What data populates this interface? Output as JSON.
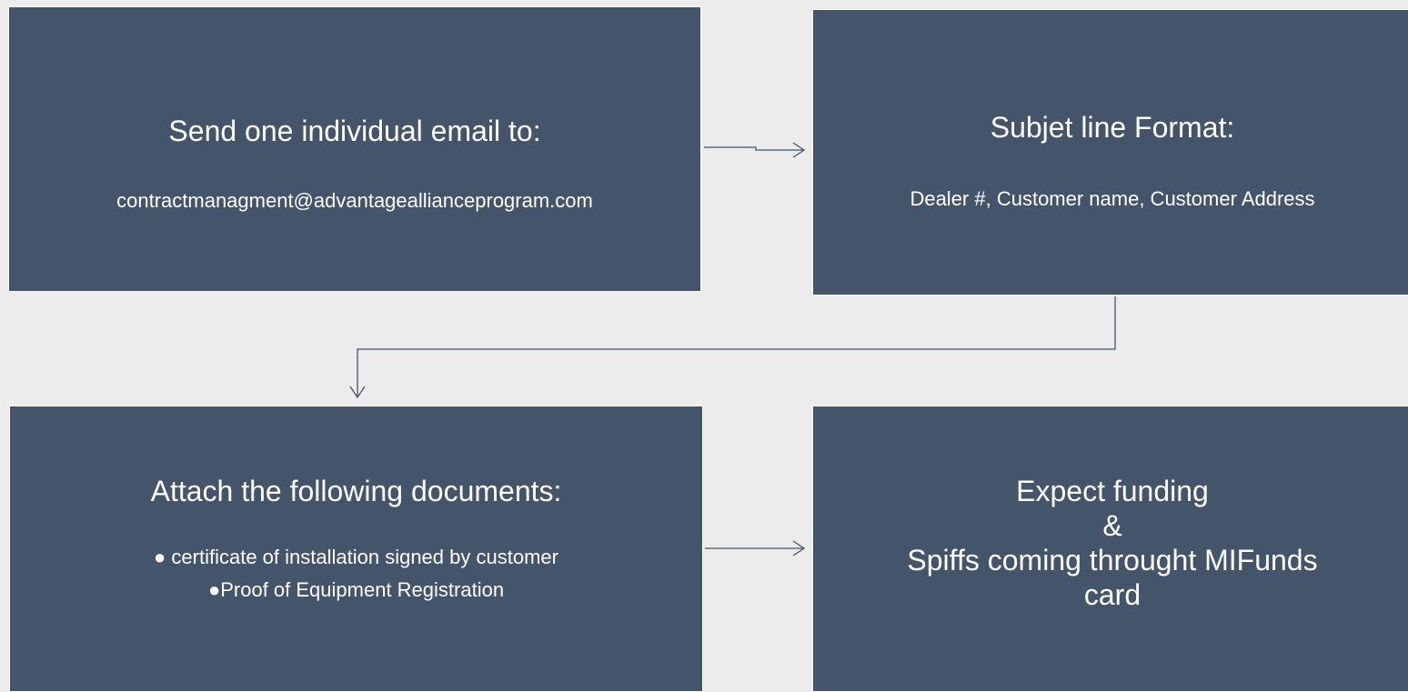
{
  "steps": [
    {
      "heading": "Send one individual email to:",
      "detail": "contractmanagment@advantageallianceprogram.com"
    },
    {
      "heading": "Subjet line Format:",
      "detail": "Dealer #, Customer name, Customer Address"
    },
    {
      "heading": "Attach the following documents:",
      "bullets": [
        "● certificate of installation signed by customer",
        "●Proof of Equipment Registration"
      ]
    },
    {
      "lines": [
        "Expect funding",
        "&",
        "Spiffs coming throught MIFunds",
        "card"
      ]
    }
  ],
  "colors": {
    "background": "#ececec",
    "box_fill": "#44546a",
    "box_text": "#ffffff",
    "connector": "#44546a"
  }
}
